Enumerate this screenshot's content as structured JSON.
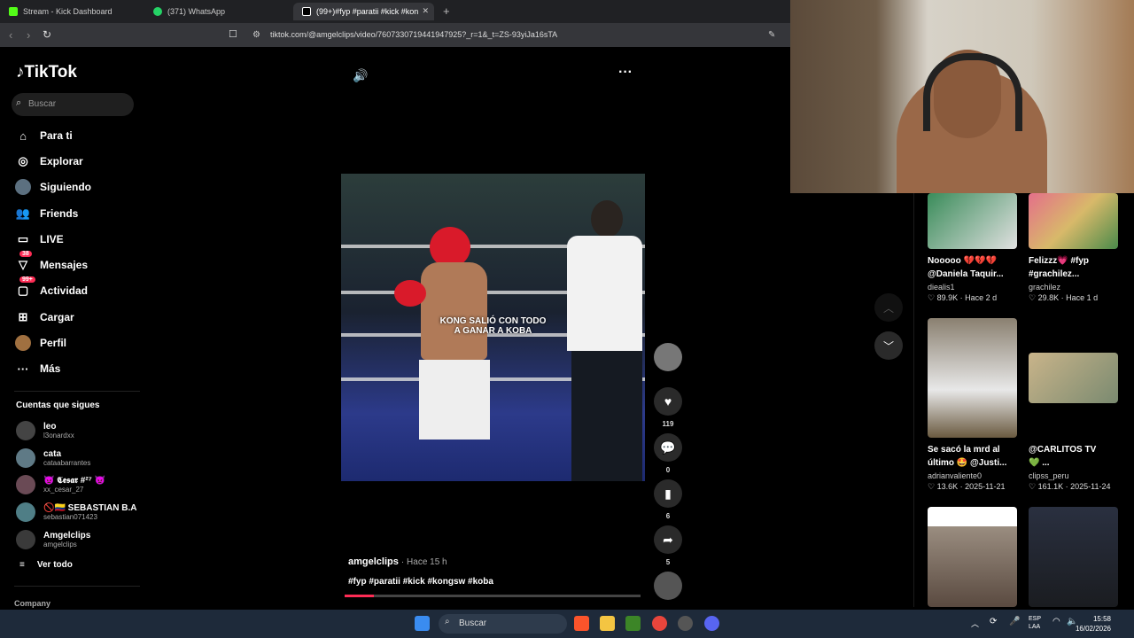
{
  "browser": {
    "tabs": [
      {
        "title": "Stream - Kick Dashboard",
        "color": "#53fc18"
      },
      {
        "title": "(371) WhatsApp",
        "color": "#25d366"
      },
      {
        "title": "(99+)#fyp #paratii #kick #kon",
        "color": "#ffffff"
      }
    ],
    "new_tab": "+",
    "close_tab": "✕",
    "url": "tiktok.com/@amgelclips/video/7607330719441947925?_r=1&_t=ZS-93yiJa16sTA"
  },
  "tiktok": {
    "logo": "TikTok",
    "search_placeholder": "Buscar",
    "nav": [
      {
        "label": "Para ti",
        "icon": "home-icon"
      },
      {
        "label": "Explorar",
        "icon": "compass-icon"
      },
      {
        "label": "Siguiendo",
        "icon": "following-avatar-icon"
      },
      {
        "label": "Friends",
        "icon": "friends-icon"
      },
      {
        "label": "LIVE",
        "icon": "live-icon"
      },
      {
        "label": "Mensajes",
        "icon": "messages-icon",
        "badge": "38"
      },
      {
        "label": "Actividad",
        "icon": "activity-icon",
        "badge": "99+"
      },
      {
        "label": "Cargar",
        "icon": "upload-icon"
      },
      {
        "label": "Perfil",
        "icon": "profile-icon"
      },
      {
        "label": "Más",
        "icon": "more-icon"
      }
    ],
    "following_title": "Cuentas que sigues",
    "following": [
      {
        "name": "leo",
        "handle": "l3onardxx"
      },
      {
        "name": "cata",
        "handle": "cataabarrantes"
      },
      {
        "name": "👿 𝕮𝖊𝖘𝖆𝖗 #²⁷ 👿",
        "handle": "xx_cesar_27"
      },
      {
        "name": "🚫🇨🇴 SEBASTIAN B.A",
        "handle": "sebastian071423"
      },
      {
        "name": "Amgelclips",
        "handle": "amgelclips"
      }
    ],
    "see_all": "Ver todo",
    "company": "Company"
  },
  "video": {
    "caption_line1": "KONG SALIÓ CON TODO",
    "caption_line2": "A GANAR A KOBA",
    "author": "amgelclips",
    "time": "· Hace 15 h",
    "hashtags": "#fyp #paratii #kick #kongsw #koba",
    "likes": "119",
    "comments": "0",
    "saves": "6",
    "shares": "5",
    "progress": 0.1
  },
  "recommended": [
    {
      "title": "Nooooo 💔💔💔",
      "title2": "@Daniela Taquir...",
      "user": "diealis1",
      "stat": "89.9K · Hace 2 d"
    },
    {
      "title": "Felizzz💗 #fyp",
      "title2": "#grachilez...",
      "user": "grachilez",
      "stat": "29.8K · Hace 1 d"
    },
    {
      "title": "Se sacó la mrd al",
      "title2": "último 🤩 @Justi...",
      "user": "adrianvaliente0",
      "stat": "13.6K · 2025-11-21"
    },
    {
      "title": "@CARLITOS TV",
      "title2": "💚 ...",
      "user": "clipss_peru",
      "stat": "161.1K · 2025-11-24"
    }
  ],
  "taskbar": {
    "search": "Buscar",
    "lang1": "ESP",
    "lang2": "LAA",
    "time": "15:58",
    "date": "16/02/2026"
  }
}
